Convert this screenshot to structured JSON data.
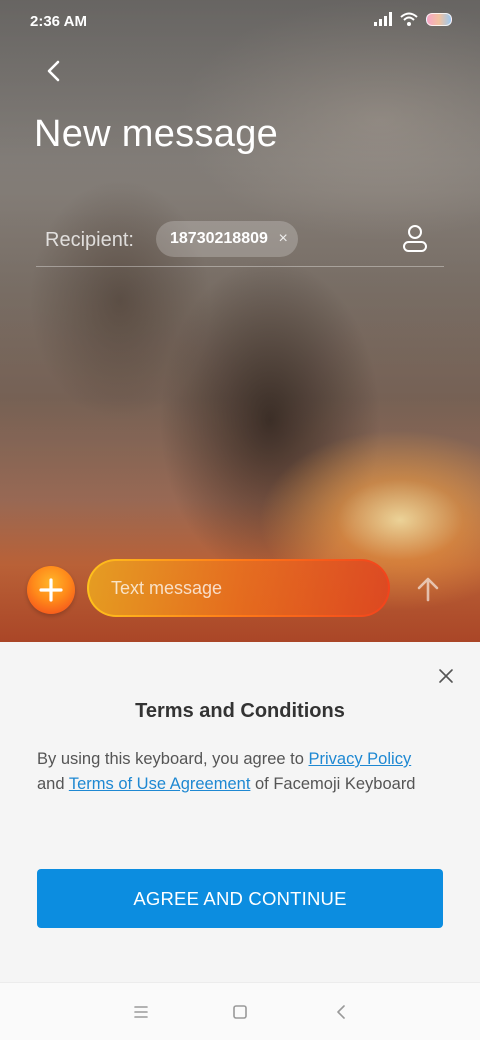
{
  "status_bar": {
    "time": "2:36 AM",
    "icons": [
      "signal-icon",
      "wifi-icon",
      "battery-icon"
    ]
  },
  "header": {
    "back_icon": "back-arrow-icon",
    "title": "New message"
  },
  "recipient": {
    "label": "Recipient:",
    "chip_value": "18730218809",
    "chip_remove": "×",
    "contact_icon": "contact-icon"
  },
  "compose": {
    "add_icon": "plus-icon",
    "placeholder": "Text message",
    "send_icon": "send-arrow-icon"
  },
  "terms_sheet": {
    "title": "Terms and Conditions",
    "body_prefix": "By using this keyboard, you agree to ",
    "privacy_link": "Privacy Policy",
    "body_and": " and ",
    "terms_link": "Terms of Use Agreement",
    "body_suffix": " of Facemoji Keyboard",
    "agree_label": "AGREE AND CONTINUE"
  },
  "nav": {
    "icons": [
      "menu-icon",
      "home-icon",
      "back-icon"
    ]
  },
  "colors": {
    "accent": "#0c8de0",
    "link": "#1e88d2",
    "add_orange": "#ff8a1a"
  }
}
